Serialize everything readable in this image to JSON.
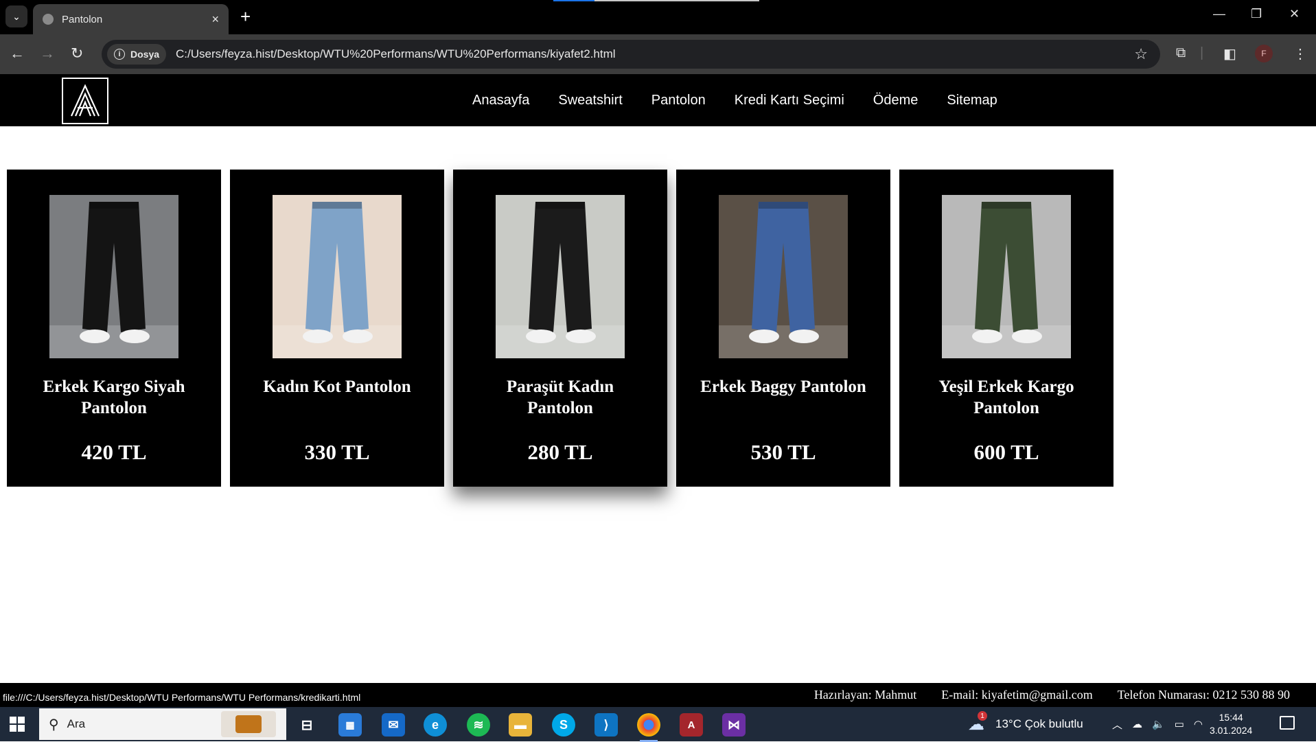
{
  "browser": {
    "tab_title": "Pantolon",
    "tab_close": "×",
    "new_tab": "+",
    "site_chip": "Dosya",
    "url": "C:/Users/feyza.hist/Desktop/WTU%20Performans/WTU%20Performans/kiyafet2.html",
    "avatar_letter": "F",
    "status_url": "file:///C:/Users/feyza.hist/Desktop/WTU Performans/WTU Performans/kredikarti.html"
  },
  "nav": {
    "items": [
      "Anasayfa",
      "Sweatshirt",
      "Pantolon",
      "Kredi Kartı Seçimi",
      "Ödeme",
      "Sitemap"
    ]
  },
  "products": [
    {
      "name": "Erkek Kargo Siyah Pantolon",
      "price": "420 TL",
      "trouser_color": "#141414",
      "bg": "#7b7d80"
    },
    {
      "name": "Kadın Kot Pantolon",
      "price": "330 TL",
      "trouser_color": "#7fa3c8",
      "bg": "#e8d9cc"
    },
    {
      "name": "Paraşüt Kadın Pantolon",
      "price": "280 TL",
      "trouser_color": "#1b1b1b",
      "bg": "#c9cbc6"
    },
    {
      "name": "Erkek Baggy Pantolon",
      "price": "530 TL",
      "trouser_color": "#3f63a1",
      "bg": "#5a5046"
    },
    {
      "name": "Yeşil Erkek Kargo Pantolon",
      "price": "600 TL",
      "trouser_color": "#3c4d34",
      "bg": "#b9b9b9"
    }
  ],
  "footer": {
    "author": "Hazırlayan: Mahmut",
    "email": "E-mail: kiyafetim@gmail.com",
    "phone": "Telefon Numarası: 0212 530 88 90"
  },
  "taskbar": {
    "search_placeholder": "Ara",
    "weather": "13°C  Çok bulutlu",
    "weather_badge": "1",
    "time": "15:44",
    "date": "3.01.2024"
  },
  "colors": {
    "page_header": "#000000",
    "card": "#000000",
    "tabstrip": "#000000",
    "toolbar": "#3c3c3c",
    "taskbar": "#1f2a3a"
  }
}
